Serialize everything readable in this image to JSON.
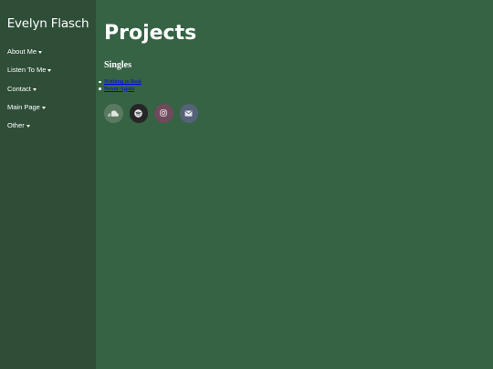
{
  "site": {
    "name": "Evelyn Flasch"
  },
  "nav": {
    "items": [
      {
        "label": "About Me"
      },
      {
        "label": "Listen To Me"
      },
      {
        "label": "Contact"
      },
      {
        "label": "Main Page"
      },
      {
        "label": "Other"
      }
    ]
  },
  "main": {
    "title": "Projects",
    "section_heading": "Singles",
    "singles": [
      {
        "label": "Nothing is Real"
      },
      {
        "label": "Never Again"
      }
    ]
  },
  "social": [
    {
      "icon": "soundcloud-icon",
      "color": "#597a60"
    },
    {
      "icon": "spotify-icon",
      "color": "#262626"
    },
    {
      "icon": "instagram-icon",
      "color": "#6e4a5c"
    },
    {
      "icon": "mail-icon",
      "color": "#556278"
    }
  ],
  "colors": {
    "background": "#356344",
    "sidebar": "#2f4e38",
    "link": "#0000ee"
  }
}
